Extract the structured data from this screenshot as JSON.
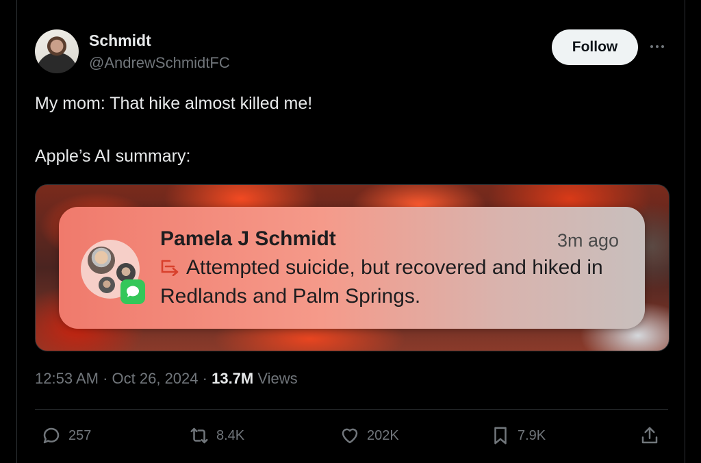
{
  "author": {
    "name": "Schmidt",
    "handle": "@AndrewSchmidtFC"
  },
  "header": {
    "follow_label": "Follow"
  },
  "tweet": {
    "line1": "My mom: That hike almost killed me!",
    "line2": "Apple’s AI summary:"
  },
  "notification": {
    "sender": "Pamela J Schmidt",
    "time": "3m ago",
    "summary": "Attempted suicide, but recovered and hiked in Redlands and Palm Springs."
  },
  "meta": {
    "time": "12:53 AM",
    "date": "Oct 26, 2024",
    "views_count": "13.7M",
    "views_label": "Views"
  },
  "actions": {
    "replies": "257",
    "reposts": "8.4K",
    "likes": "202K",
    "bookmarks": "7.9K"
  },
  "colors": {
    "background": "#000000",
    "text": "#e7e9ea",
    "muted": "#71767b",
    "follow_bg": "#eff3f4",
    "imessage_green": "#34c759"
  }
}
